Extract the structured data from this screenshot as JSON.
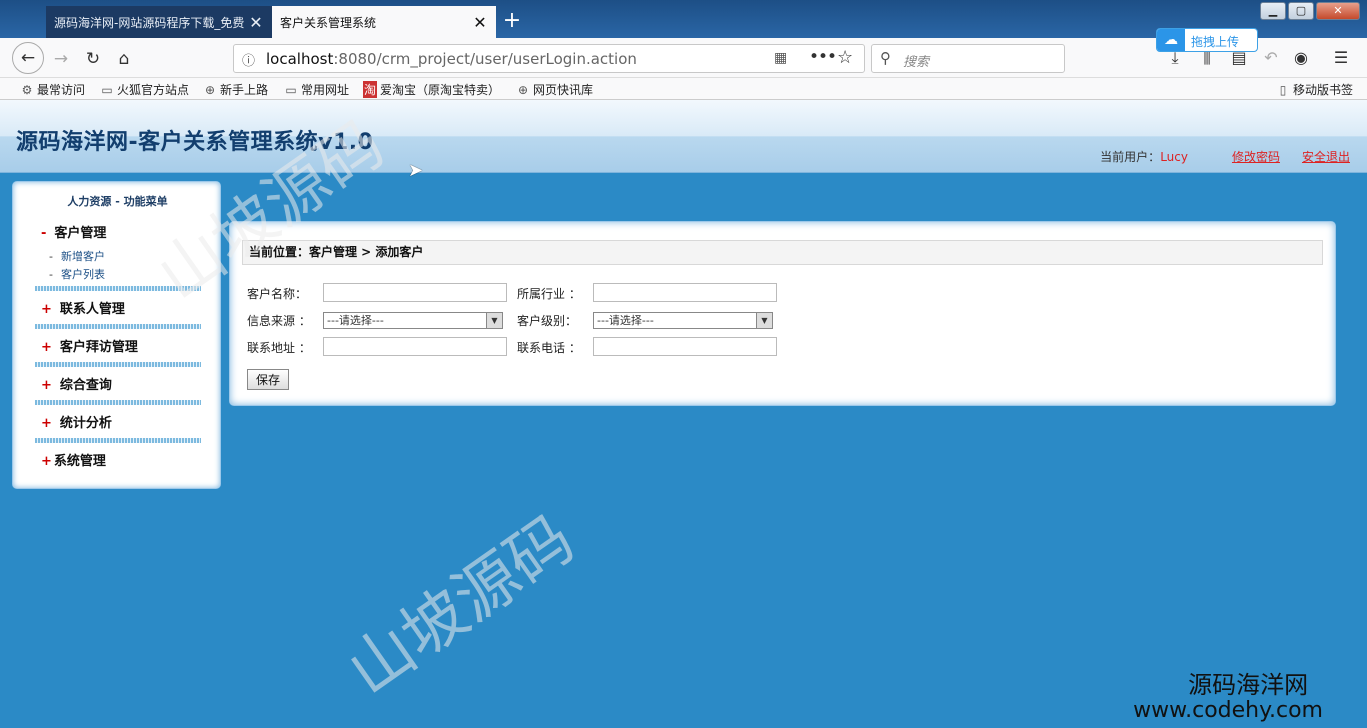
{
  "browser": {
    "tabs": [
      {
        "title": "源码海洋网-网站源码程序下载_免费",
        "active": false
      },
      {
        "title": "客户关系管理系统",
        "active": true
      }
    ],
    "url_host": "localhost",
    "url_rest": ":8080/crm_project/user/userLogin.action",
    "search_placeholder": "搜索",
    "upload_label": "拖拽上传",
    "bookmarks": [
      "最常访问",
      "火狐官方站点",
      "新手上路",
      "常用网址",
      "爱淘宝（原淘宝特卖）",
      "网页快讯库"
    ],
    "mobile_bookmarks": "移动版书签"
  },
  "header": {
    "title": "源码海洋网-客户关系管理系统v1.0",
    "current_user_label": "当前用户：",
    "current_user": "Lucy",
    "change_password": "修改密码",
    "logout": "安全退出"
  },
  "sidebar": {
    "title": "人力资源  - 功能菜单",
    "groups": [
      {
        "sign": "-",
        "label": "客户管理",
        "items": [
          "新增客户",
          "客户列表"
        ]
      },
      {
        "sign": "+",
        "label": "联系人管理"
      },
      {
        "sign": "+",
        "label": "客户拜访管理"
      },
      {
        "sign": "+",
        "label": "综合查询"
      },
      {
        "sign": "+",
        "label": "统计分析"
      },
      {
        "sign": "+",
        "label": "系统管理"
      }
    ]
  },
  "content": {
    "breadcrumb": "当前位置：客户管理 > 添加客户",
    "form": {
      "customer_name_label": "客户名称：",
      "industry_label": "所属行业 ：",
      "source_label": "信息来源 ：",
      "source_value": "---请选择---",
      "level_label": "客户级别：",
      "level_value": "---请选择---",
      "address_label": "联系地址 ：",
      "phone_label": "联系电话 ：",
      "save_label": "保存"
    }
  },
  "watermarks": {
    "wm_text": "山坡源码",
    "brand_cn": "源码海洋网",
    "brand_url": "www.codehy.com"
  }
}
